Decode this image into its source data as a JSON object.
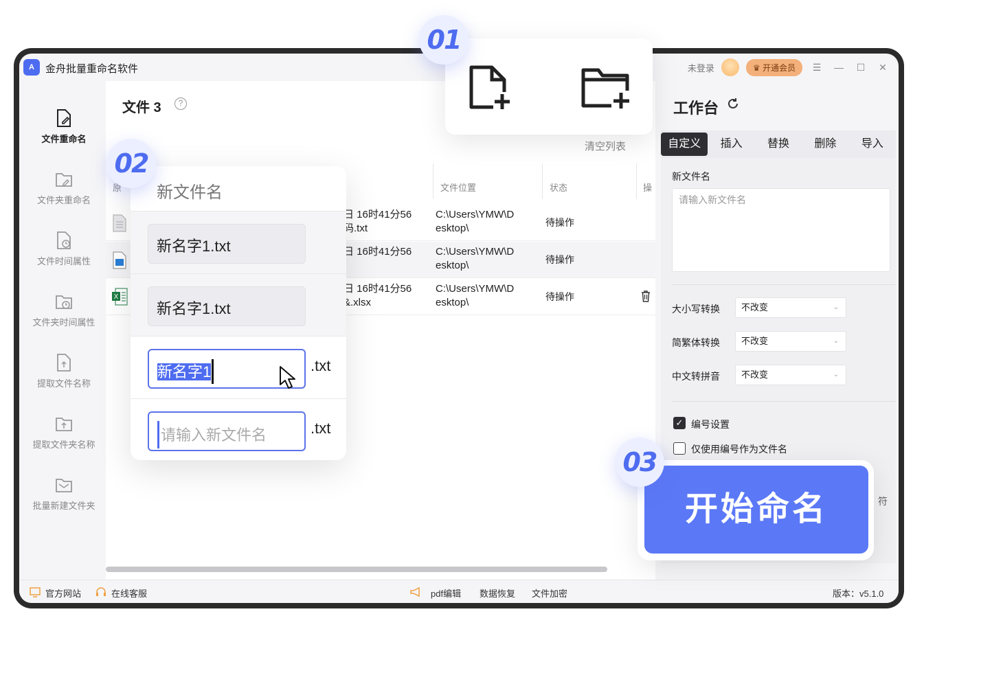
{
  "app": {
    "title": "金舟批量重命名软件",
    "logo_text": "A",
    "login": "未登录",
    "vip_label": "开通会员",
    "controls": [
      "☰",
      "—",
      "☐",
      "✕"
    ]
  },
  "sidebar": {
    "items": [
      {
        "label": "文件重命名",
        "icon": "file-edit-icon",
        "active": true
      },
      {
        "label": "文件夹重命名",
        "icon": "folder-edit-icon",
        "active": false
      },
      {
        "label": "文件时间属性",
        "icon": "file-clock-icon",
        "active": false
      },
      {
        "label": "文件夹时间属性",
        "icon": "folder-clock-icon",
        "active": false
      },
      {
        "label": "提取文件名称",
        "icon": "file-upload-icon",
        "active": false
      },
      {
        "label": "提取文件夹名称",
        "icon": "folder-upload-icon",
        "active": false
      },
      {
        "label": "批量新建文件夹",
        "icon": "mail-folder-icon",
        "active": false
      }
    ]
  },
  "main": {
    "title": "文件 3",
    "clear_list": "清空列表",
    "columns": {
      "partial_col": "原",
      "location": "文件位置",
      "status": "状态",
      "action": "操"
    },
    "rows": [
      {
        "time": "日 16时41分56",
        "name": "码.txt",
        "location_1": "C:\\Users\\YMW\\D",
        "location_2": "esktop\\",
        "status": "待操作",
        "icon": "txt-file-icon"
      },
      {
        "time": "日 16时41分56",
        "name": "",
        "location_1": "C:\\Users\\YMW\\D",
        "location_2": "esktop\\",
        "status": "待操作",
        "icon": "image-file-icon"
      },
      {
        "time": "日 16时41分56",
        "name": "&.xlsx",
        "location_1": "C:\\Users\\YMW\\D",
        "location_2": "esktop\\",
        "status": "待操作",
        "icon": "excel-file-icon"
      }
    ]
  },
  "workbench": {
    "title": "工作台",
    "tabs": [
      "自定义",
      "插入",
      "替换",
      "删除",
      "导入"
    ],
    "active_tab": "自定义",
    "new_name_label": "新文件名",
    "new_name_placeholder": "请输入新文件名",
    "case_label": "大小写转换",
    "case_value": "不改变",
    "trad_label": "简繁体转换",
    "trad_value": "不改变",
    "pinyin_label": "中文转拼音",
    "pinyin_value": "不改变",
    "numbering_label": "编号设置",
    "numbering_checked": true,
    "only_number_label": "仅使用编号作为文件名",
    "only_number_checked": false,
    "partial_char": "符"
  },
  "footer": {
    "website": "官方网站",
    "support": "在线客服",
    "pdf": "pdf编辑",
    "recovery": "数据恢复",
    "encrypt": "文件加密",
    "version": "版本：v5.1.0"
  },
  "overlay": {
    "step1": "01",
    "step2": "02",
    "step3": "03",
    "card2_header": "新文件名",
    "names": [
      "新名字1.txt",
      "新名字1.txt"
    ],
    "editing_value": "新名字1",
    "ext": ".txt",
    "empty_placeholder": "请输入新文件名",
    "start_button": "开始命名"
  },
  "colors": {
    "accent": "#5b78f6",
    "dark_tab": "#2e2e33",
    "vip": "#f3b07a"
  }
}
